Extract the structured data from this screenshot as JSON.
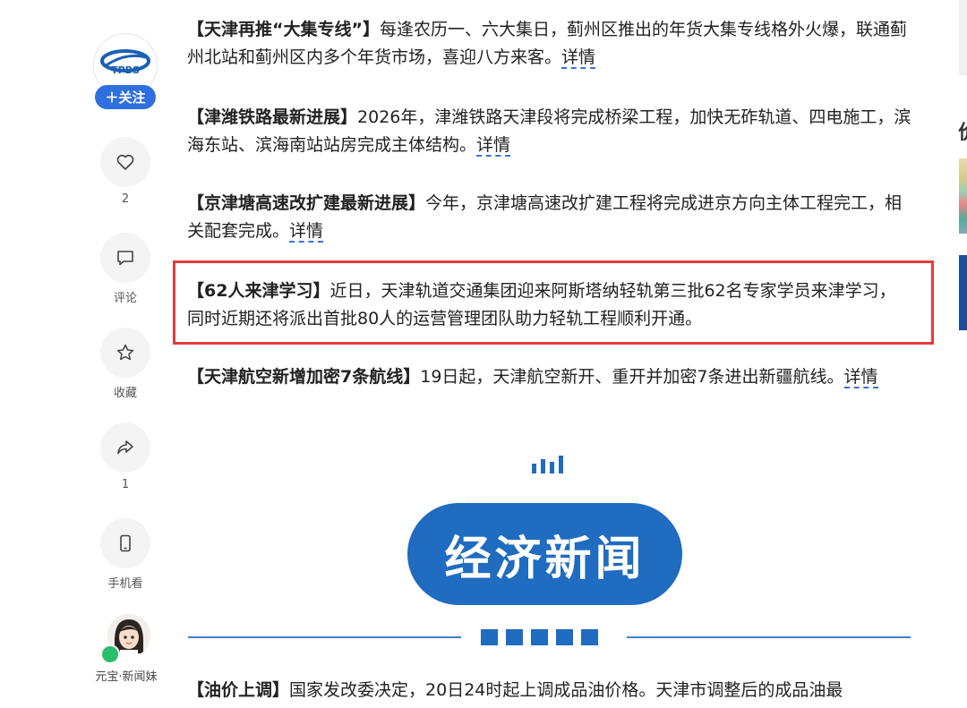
{
  "rail": {
    "logo_text": "TPBS",
    "follow_label": "＋关注",
    "like_count": "2",
    "comment_label": "评论",
    "favorite_label": "收藏",
    "share_count": "1",
    "mobile_label": "手机看",
    "assistant_label": "元宝·新闻妹"
  },
  "article": {
    "items": [
      {
        "tag": "【天津再推“大集专线”】",
        "text": "每逢农历一、六大集日，蓟州区推出的年货大集专线格外火爆，联通蓟州北站和蓟州区内多个年货市场，喜迎八方来客。",
        "link": "详情"
      },
      {
        "tag": "【津潍铁路最新进展】",
        "text": "2026年，津潍铁路天津段将完成桥梁工程，加快无砟轨道、四电施工，滨海东站、滨海南站站房完成主体结构。",
        "link": "详情"
      },
      {
        "tag": "【京津塘高速改扩建最新进展】",
        "text": "今年，京津塘高速改扩建工程将完成进京方向主体工程完工，相关配套完成。",
        "link": "详情"
      },
      {
        "tag": "【62人来津学习】",
        "text": "近日，天津轨道交通集团迎来阿斯塔纳轻轨第三批62名专家学员来津学习，同时近期还将派出首批80人的运营管理团队助力轻轨工程顺利开通。"
      },
      {
        "tag": "【天津航空新增加密7条航线】",
        "text": "19日起，天津航空新开、重开并加密7条进出新疆航线。",
        "link": "详情"
      },
      {
        "tag": "【油价上调】",
        "text": "国家发改委决定，20日24时起上调成品油价格。天津市调整后的成品油最"
      }
    ],
    "section_title": "经济新闻"
  },
  "side": {
    "partial_char": "价"
  },
  "colors": {
    "accent_blue": "#1f6cc0",
    "follow_blue": "#2f6fe0",
    "highlight_red": "#e33b3b"
  }
}
